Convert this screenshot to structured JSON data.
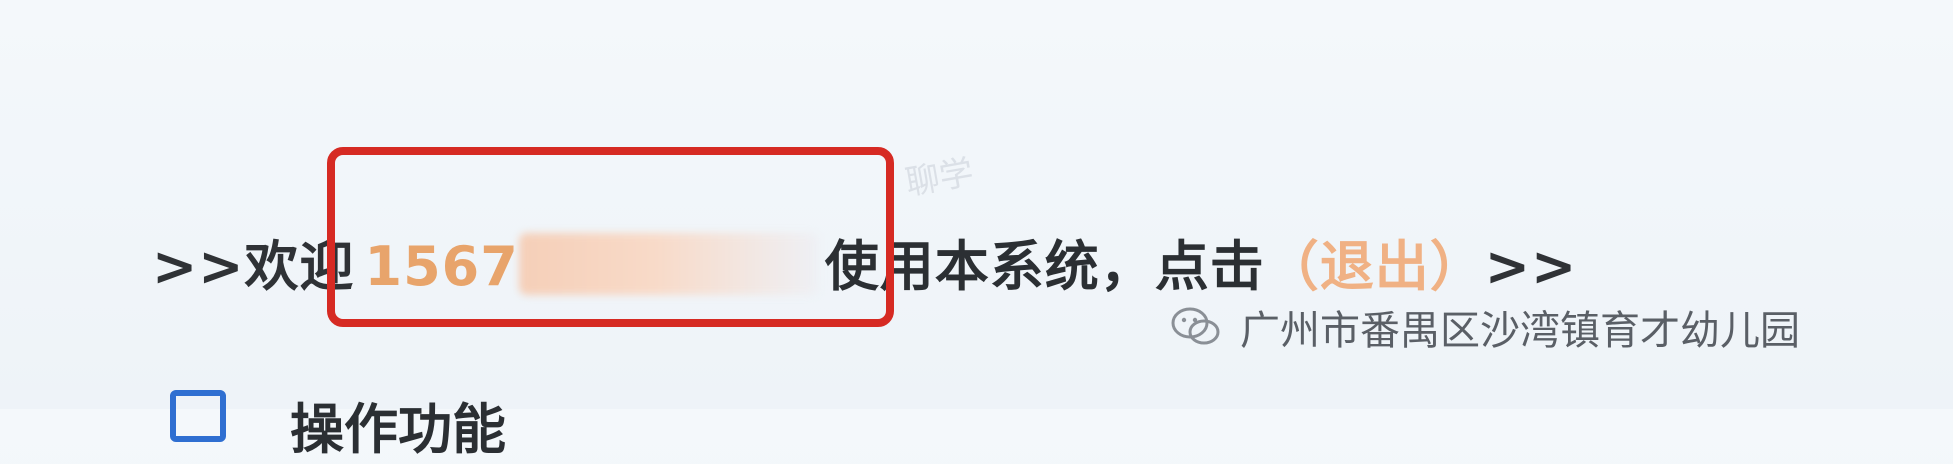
{
  "welcome": {
    "prefix": ">>欢迎",
    "username_visible": "1567",
    "middle": "使用本系统，点击",
    "logout_link": "（退出）",
    "suffix": ">>"
  },
  "watermark": {
    "faint_text": "聊学",
    "source": "广州市番禺区沙湾镇育才幼儿园"
  },
  "bottom": {
    "partial_heading": "操作功能"
  },
  "colors": {
    "username": "#e8a46b",
    "logout": "#f0b184",
    "highlight_border": "#d62a23",
    "icon_blue": "#2f6fd1"
  }
}
